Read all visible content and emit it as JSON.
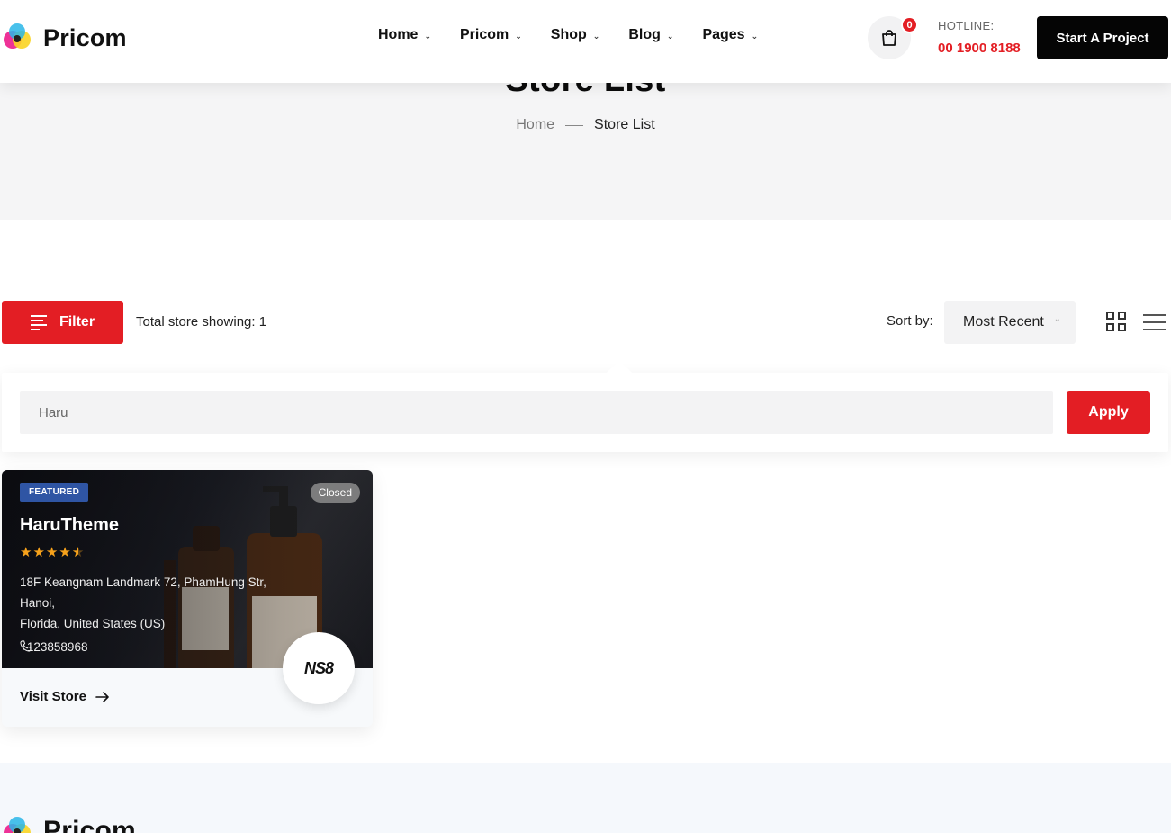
{
  "header": {
    "logo_text": "Pricom",
    "nav": [
      {
        "label": "Home"
      },
      {
        "label": "Pricom"
      },
      {
        "label": "Shop"
      },
      {
        "label": "Blog"
      },
      {
        "label": "Pages"
      }
    ],
    "cart_count": "0",
    "hotline_label": "HOTLINE:",
    "hotline_number": "00 1900 8188",
    "cta_label": "Start A Project"
  },
  "page": {
    "title": "Store List",
    "breadcrumb": {
      "home": "Home",
      "current": "Store List"
    }
  },
  "toolbar": {
    "filter_label": "Filter",
    "total_text": "Total store showing: 1",
    "sort_label": "Sort by:",
    "sort_value": "Most Recent"
  },
  "filter": {
    "search_value": "Haru",
    "apply_label": "Apply"
  },
  "stores": [
    {
      "badge": "FEATURED",
      "status": "Closed",
      "name": "HaruTheme",
      "rating": 4.5,
      "address_line1": "18F Keangnam Landmark 72, PhamHung Str,",
      "address_line2": "Hanoi,",
      "address_line3": "Florida, United States (US)",
      "phone": "+123858968",
      "visit_label": "Visit Store",
      "logo_text": "NS8"
    }
  ],
  "footer": {
    "logo_text": "Pricom"
  },
  "colors": {
    "accent": "#e31e24",
    "dark": "#050505",
    "featured_badge": "#2f55a4",
    "star": "#f7a21b"
  }
}
